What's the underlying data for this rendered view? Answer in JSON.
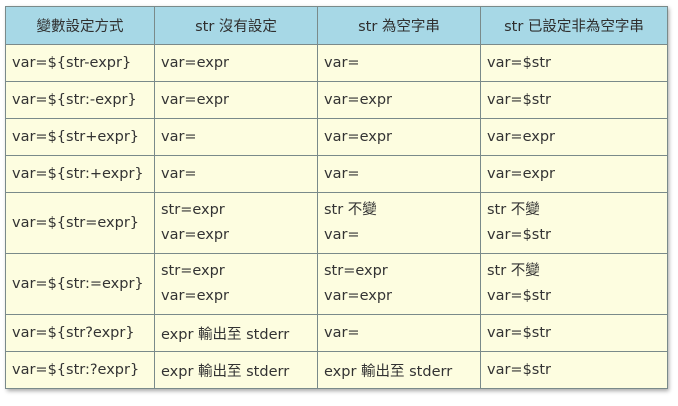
{
  "header": {
    "col1": "變數設定方式",
    "col2": "str 沒有設定",
    "col3": "str 為空字串",
    "col4": "str 已設定非為空字串"
  },
  "rows": [
    {
      "method": "var=${str-expr}",
      "unset": [
        "var=expr"
      ],
      "empty": [
        "var="
      ],
      "set": [
        "var=$str"
      ]
    },
    {
      "method": "var=${str:-expr}",
      "unset": [
        "var=expr"
      ],
      "empty": [
        "var=expr"
      ],
      "set": [
        "var=$str"
      ]
    },
    {
      "method": "var=${str+expr}",
      "unset": [
        "var="
      ],
      "empty": [
        "var=expr"
      ],
      "set": [
        "var=expr"
      ]
    },
    {
      "method": "var=${str:+expr}",
      "unset": [
        "var="
      ],
      "empty": [
        "var="
      ],
      "set": [
        "var=expr"
      ]
    },
    {
      "method": "var=${str=expr}",
      "unset": [
        "str=expr",
        "var=expr"
      ],
      "empty": [
        "str 不變",
        "var="
      ],
      "set": [
        "str 不變",
        "var=$str"
      ]
    },
    {
      "method": "var=${str:=expr}",
      "unset": [
        "str=expr",
        "var=expr"
      ],
      "empty": [
        "str=expr",
        "var=expr"
      ],
      "set": [
        "str 不變",
        "var=$str"
      ]
    },
    {
      "method": "var=${str?expr}",
      "unset": [
        "expr 輸出至 stderr"
      ],
      "empty": [
        "var="
      ],
      "set": [
        "var=$str"
      ]
    },
    {
      "method": "var=${str:?expr}",
      "unset": [
        "expr 輸出至 stderr"
      ],
      "empty": [
        "expr 輸出至 stderr"
      ],
      "set": [
        "var=$str"
      ]
    }
  ]
}
